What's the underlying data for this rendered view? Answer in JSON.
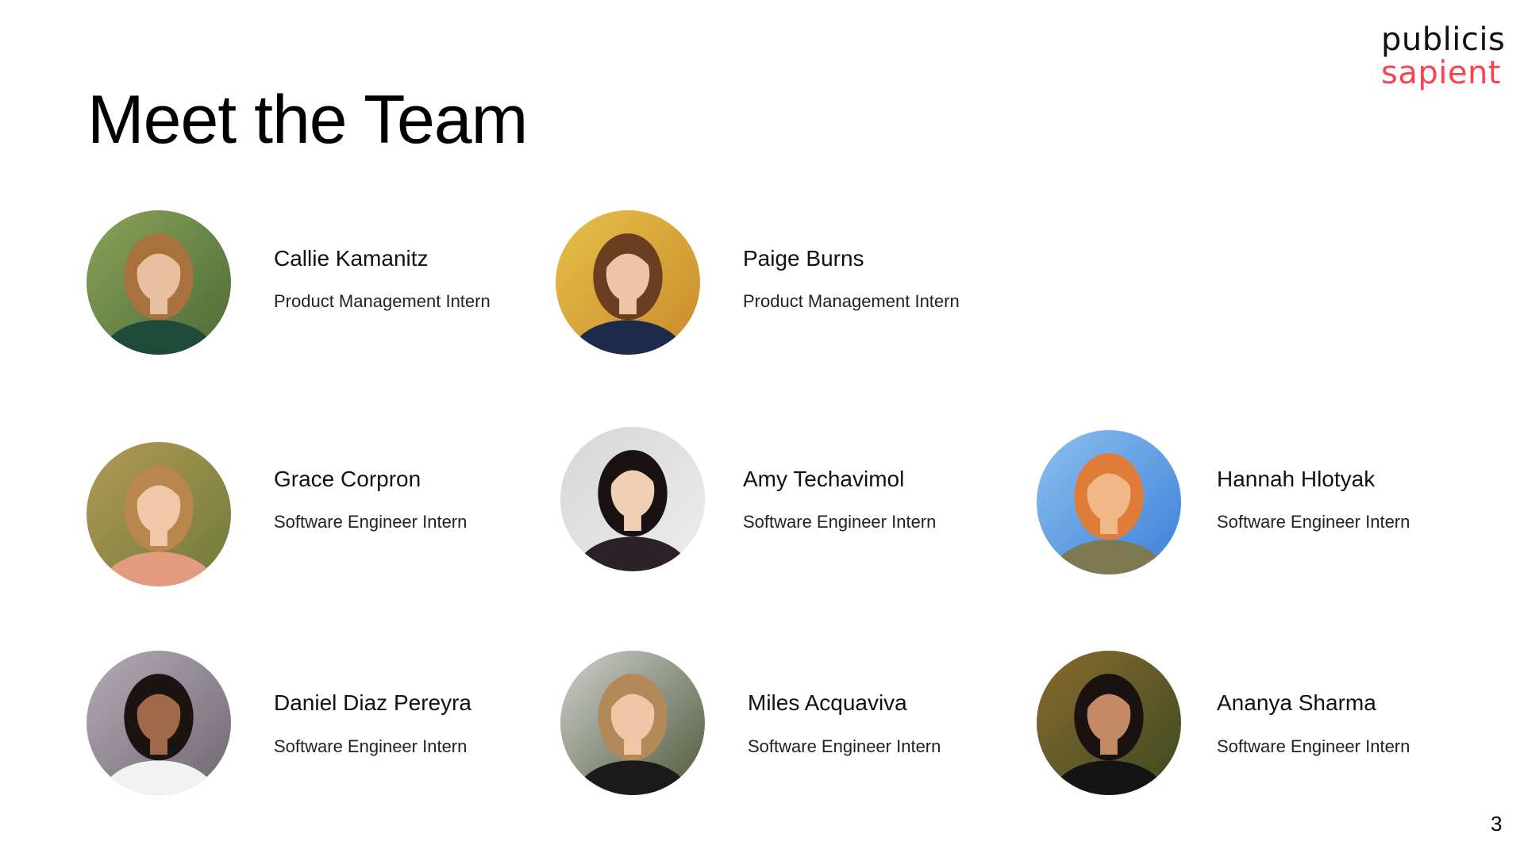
{
  "title": "Meet the Team",
  "logo": {
    "line1": "publicis",
    "line2": "sapient",
    "accent_color": "#fe414d"
  },
  "page_number": "3",
  "members": [
    {
      "name": "Callie Kamanitz",
      "role": "Product Management Intern",
      "photo": {
        "bg": "#4b6b36",
        "bg2": "#8aa35a",
        "skin": "#e8c0a0",
        "hair": "#a8713d",
        "shirt": "#1f4a3a"
      }
    },
    {
      "name": "Paige Burns",
      "role": "Product Management Intern",
      "photo": {
        "bg": "#c98a2a",
        "bg2": "#e6c04a",
        "skin": "#edc4a6",
        "hair": "#6b3e22",
        "shirt": "#1e2a4a"
      }
    },
    {
      "name": "Grace Corpron",
      "role": "Software Engineer Intern",
      "photo": {
        "bg": "#6d7a3a",
        "bg2": "#b39a55",
        "skin": "#f0c8a8",
        "hair": "#b9864e",
        "shirt": "#e39a7e"
      }
    },
    {
      "name": "Amy Techavimol",
      "role": "Software Engineer Intern",
      "photo": {
        "bg": "#ededed",
        "bg2": "#d6d6d6",
        "skin": "#f1cfb4",
        "hair": "#1a1212",
        "shirt": "#2a2226"
      }
    },
    {
      "name": "Hannah Hlotyak",
      "role": "Software Engineer Intern",
      "photo": {
        "bg": "#3a7fd6",
        "bg2": "#8ec0f0",
        "skin": "#f0b888",
        "hair": "#e07c3a",
        "shirt": "#7d7a52"
      }
    },
    {
      "name": "Daniel Diaz Pereyra",
      "role": "Software Engineer Intern",
      "photo": {
        "bg": "#6e6570",
        "bg2": "#b3acb6",
        "skin": "#a06a4a",
        "hair": "#1c1410",
        "shirt": "#f2f2f2"
      }
    },
    {
      "name": "Miles Acquaviva",
      "role": "Software Engineer Intern",
      "photo": {
        "bg": "#4f5a3a",
        "bg2": "#cfcfcf",
        "skin": "#f0c6a6",
        "hair": "#b4895a",
        "shirt": "#1a1a1a"
      }
    },
    {
      "name": "Ananya Sharma",
      "role": "Software Engineer Intern",
      "photo": {
        "bg": "#3b4a22",
        "bg2": "#8a6a2e",
        "skin": "#c48a66",
        "hair": "#1a1210",
        "shirt": "#141414"
      }
    }
  ]
}
